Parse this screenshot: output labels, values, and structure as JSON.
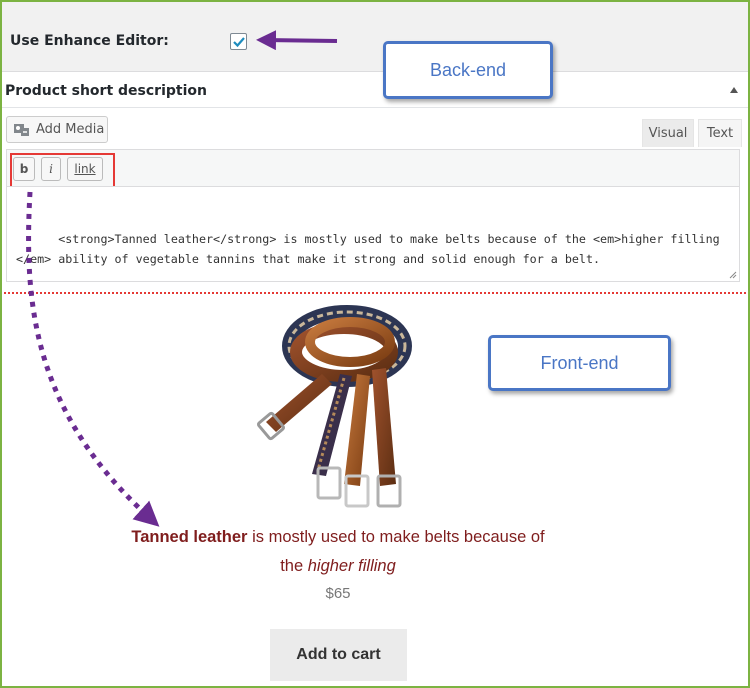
{
  "settings": {
    "enhance_editor_label": "Use Enhance Editor:",
    "enhance_editor_checked": true
  },
  "metabox": {
    "title": "Product short description",
    "add_media_label": "Add Media",
    "tabs": [
      {
        "label": "Visual",
        "active": false
      },
      {
        "label": "Text",
        "active": true
      }
    ],
    "quicktags": [
      "b",
      "i",
      "link"
    ],
    "content": "<strong>Tanned leather</strong> is mostly used to make belts because of the <em>higher filling</em> ability of vegetable tannins that make it strong and solid enough for a belt."
  },
  "callouts": {
    "backend": "Back-end",
    "frontend": "Front-end"
  },
  "product": {
    "desc_bold": "Tanned leather",
    "desc_mid": " is mostly used to make belts because of the ",
    "desc_italic": "higher filling",
    "price": "$65",
    "add_to_cart": "Add to cart"
  },
  "colors": {
    "frame": "#7cb342",
    "arrow": "#6a2c91",
    "callout": "#4a76c5",
    "highlight": "#e53935",
    "product_text": "#7f1d1d"
  },
  "icons": [
    "checkmark-icon",
    "collapse-arrow-icon",
    "add-media-icon",
    "resize-grip-icon",
    "belts-product-image",
    "arrow-annotation"
  ]
}
